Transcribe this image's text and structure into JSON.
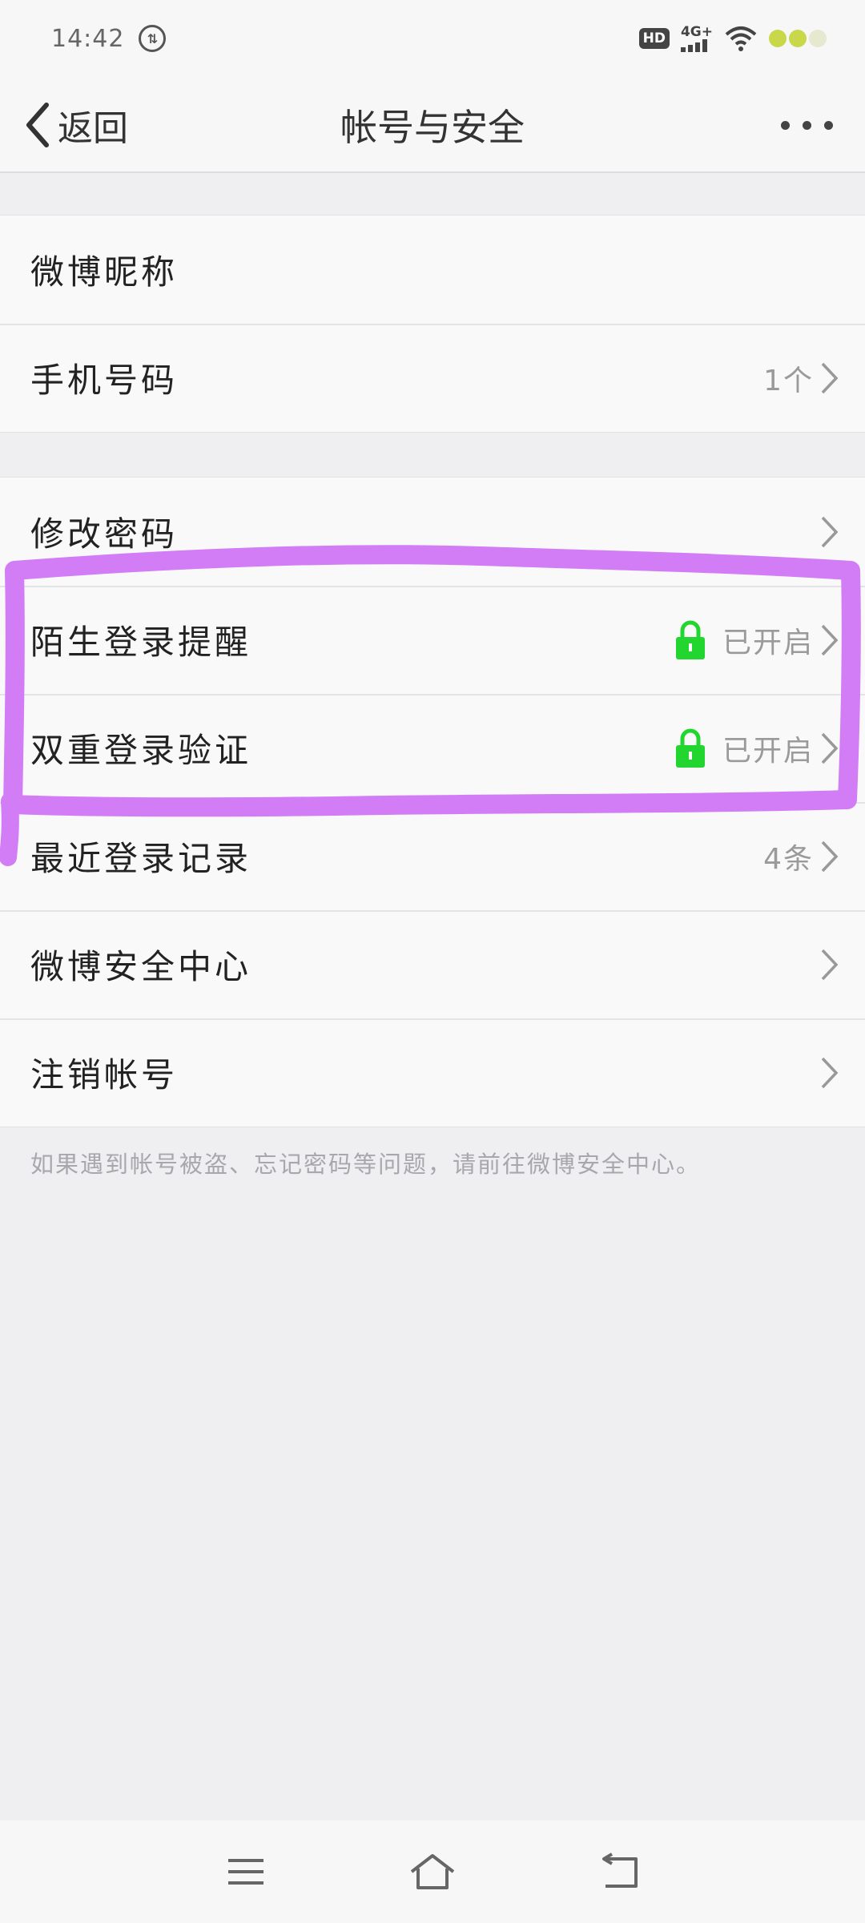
{
  "status_bar": {
    "time": "14:42",
    "data_icon": "data-saver-icon",
    "hd": "HD",
    "network": "4G+",
    "battery_colors": [
      "#c8d84a",
      "#c8d84a",
      "#e6e8cf"
    ]
  },
  "nav": {
    "back_label": "返回",
    "title": "帐号与安全",
    "more_icon": "more-dots-icon"
  },
  "group1": [
    {
      "label": "微博昵称",
      "value": ""
    },
    {
      "label": "手机号码",
      "value": "1个"
    }
  ],
  "group2": [
    {
      "label": "修改密码",
      "value": ""
    },
    {
      "label": "陌生登录提醒",
      "value": "已开启",
      "lock": true
    },
    {
      "label": "双重登录验证",
      "value": "已开启",
      "lock": true
    },
    {
      "label": "最近登录记录",
      "value": "4条"
    },
    {
      "label": "微博安全中心",
      "value": ""
    },
    {
      "label": "注销帐号",
      "value": ""
    }
  ],
  "footer_note": "如果遇到帐号被盗、忘记密码等问题，请前往微博安全中心。",
  "colors": {
    "lock_green": "#22d62f",
    "annotation_purple": "#d27cf5"
  },
  "system_nav": {
    "menu_icon": "menu-icon",
    "home_icon": "home-icon",
    "back_icon": "back-icon"
  }
}
